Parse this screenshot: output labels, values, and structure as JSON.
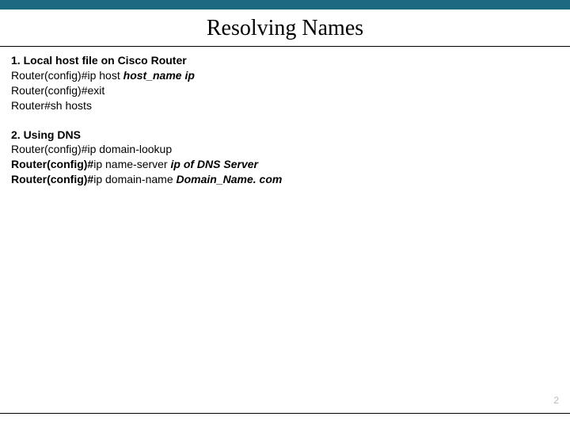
{
  "title": "Resolving Names",
  "section1": {
    "heading": "1. Local host file on Cisco Router",
    "line1_a": "Router(config)#ip host ",
    "line1_b": "host_name ip",
    "line2": "Router(config)#exit",
    "line3": "Router#sh hosts"
  },
  "section2": {
    "heading": "2. Using DNS",
    "line1": "Router(config)#ip domain-lookup",
    "line2_a": "Router(config)#",
    "line2_b": "ip name-server ",
    "line2_c": "ip of DNS Server",
    "line3_a": "Router(config)#",
    "line3_b": "ip domain-name ",
    "line3_c": "Domain_Name. com"
  },
  "page_number": "2"
}
